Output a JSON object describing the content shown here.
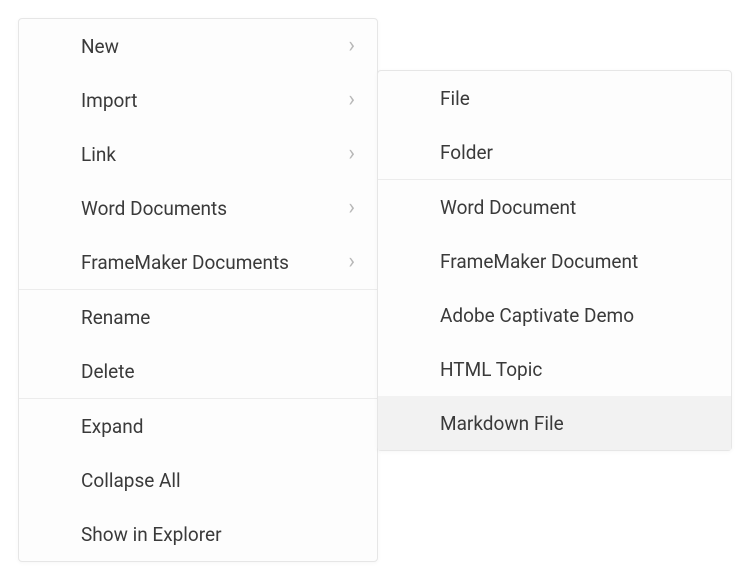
{
  "primaryMenu": {
    "group1": [
      {
        "label": "New",
        "hasSubmenu": true
      },
      {
        "label": "Import",
        "hasSubmenu": true
      },
      {
        "label": "Link",
        "hasSubmenu": true
      },
      {
        "label": "Word Documents",
        "hasSubmenu": true
      },
      {
        "label": "FrameMaker Documents",
        "hasSubmenu": true
      }
    ],
    "group2": [
      {
        "label": "Rename"
      },
      {
        "label": "Delete"
      }
    ],
    "group3": [
      {
        "label": "Expand"
      },
      {
        "label": "Collapse All"
      },
      {
        "label": "Show in Explorer"
      }
    ]
  },
  "secondaryMenu": {
    "group1": [
      {
        "label": "File"
      },
      {
        "label": "Folder"
      }
    ],
    "group2": [
      {
        "label": "Word Document"
      },
      {
        "label": "FrameMaker Document"
      },
      {
        "label": "Adobe Captivate Demo"
      },
      {
        "label": "HTML Topic"
      },
      {
        "label": "Markdown File",
        "hovered": true
      }
    ]
  },
  "chevronGlyph": "›"
}
